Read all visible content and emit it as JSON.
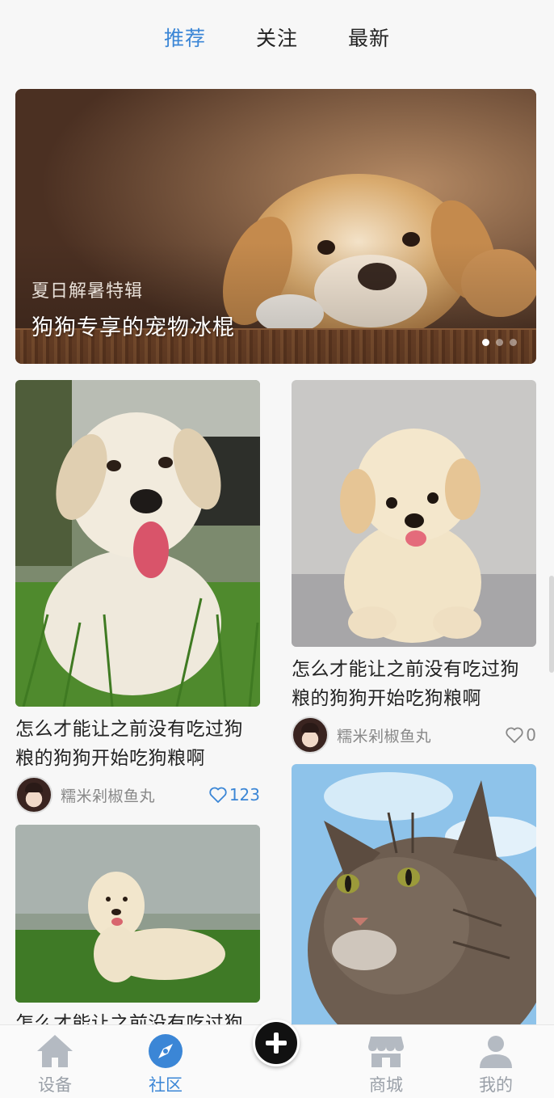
{
  "tabs": [
    {
      "label": "推荐",
      "active": true
    },
    {
      "label": "关注",
      "active": false
    },
    {
      "label": "最新",
      "active": false
    }
  ],
  "banner": {
    "subtitle": "夏日解暑特辑",
    "title": "狗狗专享的宠物冰棍",
    "dots": 3,
    "active_dot": 0
  },
  "posts": [
    {
      "caption": "怎么才能让之前没有吃过狗粮的狗狗开始吃狗粮啊",
      "username": "糯米剁椒鱼丸",
      "likes": "123",
      "liked": true,
      "image": "labrador-puppy-photo"
    },
    {
      "caption": "怎么才能让之前没有吃过狗粮的狗狗开始吃狗粮啊",
      "username": "糯米剁椒鱼丸",
      "likes": "0",
      "liked": false,
      "image": "poodle-puppy-photo"
    },
    {
      "caption": "怎么才能让之前没有吃过狗",
      "image": "golden-retriever-photo"
    },
    {
      "image": "tabby-cat-photo"
    }
  ],
  "bottom_nav": {
    "items": [
      {
        "label": "设备",
        "icon": "home-icon",
        "active": false
      },
      {
        "label": "社区",
        "icon": "compass-icon",
        "active": true
      },
      {
        "label": "商城",
        "icon": "shop-icon",
        "active": false
      },
      {
        "label": "我的",
        "icon": "user-icon",
        "active": false
      }
    ],
    "fab_icon": "plus-icon"
  },
  "colors": {
    "accent": "#3b86d6",
    "muted": "#9aa0a8",
    "fab": "#111111"
  }
}
